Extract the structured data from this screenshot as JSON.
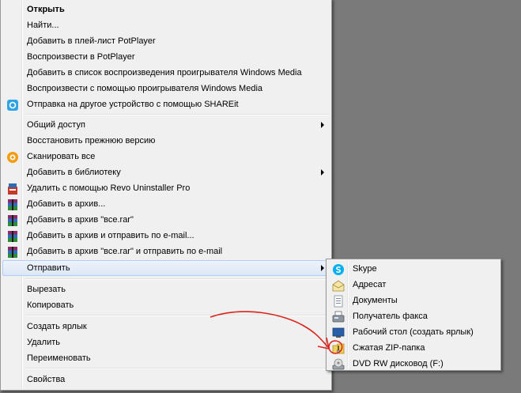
{
  "context_menu": {
    "items": [
      {
        "label": "Открыть",
        "icon": "",
        "submenu": false
      },
      {
        "label": "Найти...",
        "icon": "",
        "submenu": false
      },
      {
        "label": "Добавить в плей-лист PotPlayer",
        "icon": "",
        "submenu": false
      },
      {
        "label": "Воспроизвести в PotPlayer",
        "icon": "",
        "submenu": false
      },
      {
        "label": "Добавить в список воспроизведения проигрывателя Windows Media",
        "icon": "",
        "submenu": false
      },
      {
        "label": "Воспроизвести с помощью проигрывателя Windows Media",
        "icon": "",
        "submenu": false
      },
      {
        "label": "Отправка на другое устройство с помощью SHAREit",
        "icon": "shareit-icon",
        "submenu": false
      },
      {
        "label": "Общий доступ",
        "icon": "",
        "submenu": true
      },
      {
        "label": "Восстановить прежнюю версию",
        "icon": "",
        "submenu": false
      },
      {
        "label": "Сканировать все",
        "icon": "antivirus-scan-icon",
        "submenu": false
      },
      {
        "label": "Добавить в библиотеку",
        "icon": "",
        "submenu": true
      },
      {
        "label": "Удалить с помощью Revo Uninstaller Pro",
        "icon": "revo-uninstaller-icon",
        "submenu": false
      },
      {
        "label": "Добавить в архив...",
        "icon": "winrar-icon",
        "submenu": false
      },
      {
        "label": "Добавить в архив \"все.rar\"",
        "icon": "winrar-icon",
        "submenu": false
      },
      {
        "label": "Добавить в архив и отправить по e-mail...",
        "icon": "winrar-icon",
        "submenu": false
      },
      {
        "label": "Добавить в архив \"все.rar\" и отправить по e-mail",
        "icon": "winrar-icon",
        "submenu": false
      },
      {
        "label": "Отправить",
        "icon": "",
        "submenu": true
      },
      {
        "label": "Вырезать",
        "icon": "",
        "submenu": false
      },
      {
        "label": "Копировать",
        "icon": "",
        "submenu": false
      },
      {
        "label": "Создать ярлык",
        "icon": "",
        "submenu": false
      },
      {
        "label": "Удалить",
        "icon": "",
        "submenu": false
      },
      {
        "label": "Переименовать",
        "icon": "",
        "submenu": false
      },
      {
        "label": "Свойства",
        "icon": "",
        "submenu": false
      }
    ]
  },
  "send_to_menu": {
    "items": [
      {
        "label": "Skype",
        "icon": "skype-icon"
      },
      {
        "label": "Адресат",
        "icon": "mail-recipient-icon"
      },
      {
        "label": "Документы",
        "icon": "documents-icon"
      },
      {
        "label": "Получатель факса",
        "icon": "fax-icon"
      },
      {
        "label": "Рабочий стол (создать ярлык)",
        "icon": "desktop-icon"
      },
      {
        "label": "Сжатая ZIP-папка",
        "icon": "zip-folder-icon"
      },
      {
        "label": "DVD RW дисковод (F:)",
        "icon": "dvd-drive-icon"
      }
    ]
  },
  "colors": {
    "desktop": "#7a7a7a",
    "menu_bg": "#f0f0f0",
    "highlight": "#dce7f6",
    "annotation": "#d9251d"
  }
}
